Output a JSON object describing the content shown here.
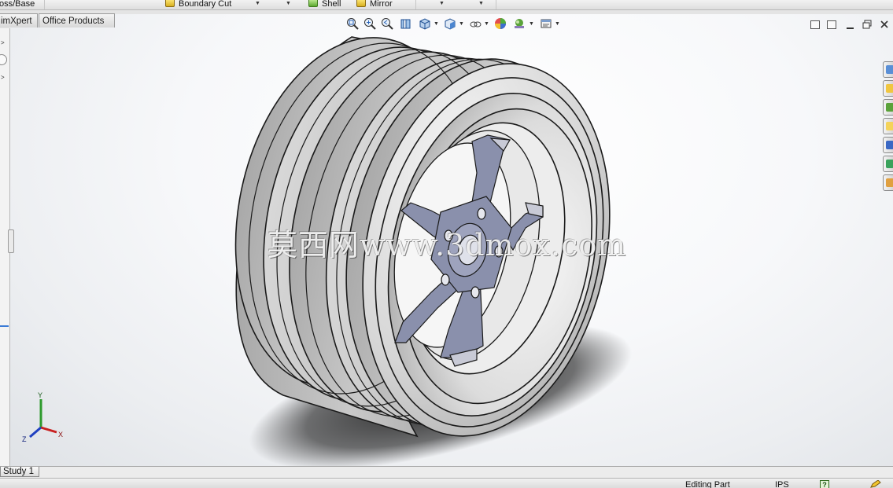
{
  "toolbar": {
    "items": [
      {
        "label": "oss/Base"
      },
      {
        "label": "Boundary Cut"
      },
      {
        "label": "Shell"
      },
      {
        "label": "Mirror"
      }
    ]
  },
  "tabs": [
    {
      "label": "imXpert"
    },
    {
      "label": "Office Products"
    }
  ],
  "watermark": "莫西网www.3dmox.com",
  "triad": {
    "x": "X",
    "y": "Y",
    "z": "Z"
  },
  "study_tab": "Study 1",
  "status": {
    "mode": "Editing Part",
    "units": "IPS",
    "help": "?"
  },
  "colors": {
    "accent": "#3b7bd6",
    "model_gray": "#b9b9b9",
    "spoke_blue": "#8a90ac",
    "viewport_bg": "#f4f5f7"
  },
  "icons": {
    "hud": [
      "zoom-to-fit-icon",
      "zoom-area-icon",
      "previous-view-icon",
      "section-view-icon",
      "view-orientation-icon",
      "display-style-icon",
      "hide-show-icon",
      "edit-appearance-icon",
      "apply-scene-icon",
      "view-settings-icon"
    ],
    "taskpane": [
      "solidworks-resources-icon",
      "design-library-icon",
      "file-explorer-icon",
      "view-palette-icon",
      "appearances-icon",
      "custom-properties-icon",
      "extra-pane-icon"
    ]
  }
}
